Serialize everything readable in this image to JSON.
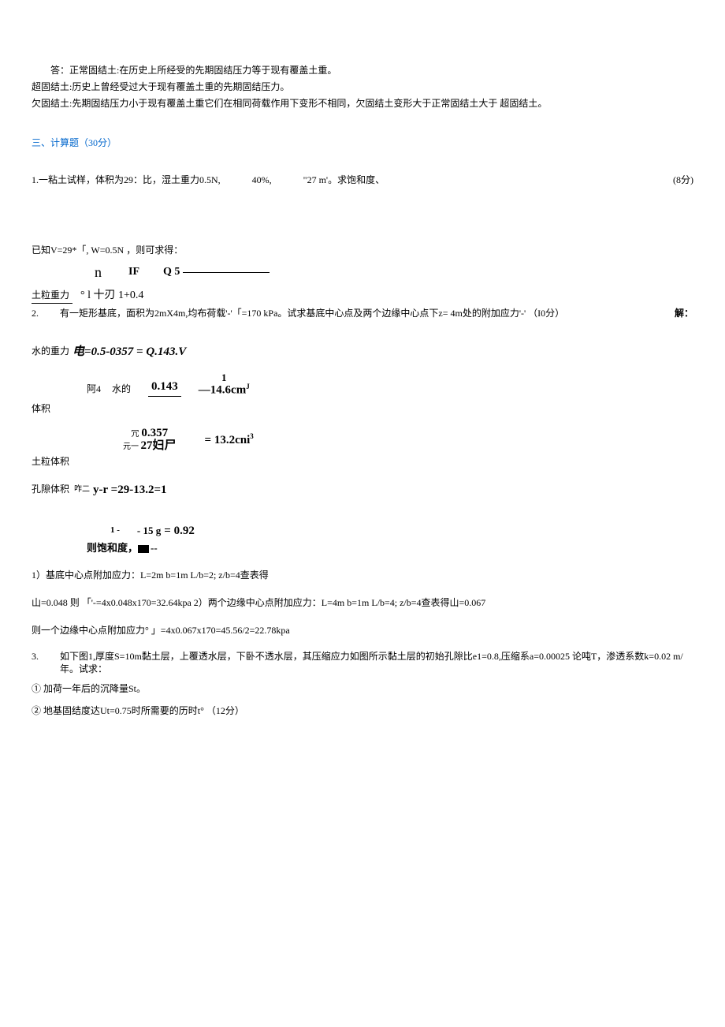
{
  "answer": {
    "line1": "答：正常固结土:在历史上所经受的先期固结压力等于现有覆盖土重。",
    "line2": "超固结土:历史上曾经受过大于现有覆盖土重的先期固结压力。",
    "line3": "欠固结土:先期固结压力小于现有覆盖土重它们在相同荷载作用下变形不相同，欠固结土变形大于正常固结土大于 超固结土。"
  },
  "section3": {
    "title": "三、计算题（30分）"
  },
  "q1": {
    "seg1": "1.一粘土试样，体积为29：比，湿土重力0.5N,",
    "seg2": "40%,",
    "seg3": "\"27 m'。求饱和度、",
    "seg4": "(8分)"
  },
  "known": "已知V=29*「, W=0.5N ，则可求得：",
  "eq1": {
    "top_n": "n",
    "top_if": "IF",
    "top_q5": "Q 5",
    "label": "土粒重力",
    "bot": "° l 十刃 1+0.4"
  },
  "q2": {
    "num": "2.",
    "body": "有一矩形基底，面积为2mX4m,均布荷载'-'「=170 kPa。试求基底中心点及两个边缘中心点下z= 4m处的附加应力'-' （I0分）",
    "end": "解："
  },
  "water_weight": {
    "label": "水的重力",
    "eq": "电=0.5-0357 = Q.143.V"
  },
  "water_vol": {
    "seg1": "阿4",
    "seg2": "水的",
    "seg3": "0.143",
    "seg4": "—14.6cm",
    "sup": "J",
    "sup_pre": "1",
    "label": "体积"
  },
  "soil_vol": {
    "pre1": "冗",
    "v1": "0.357",
    "pre2": "元一",
    "v2": "27妇尸",
    "eq": "= 13.2cni",
    "sup": "3",
    "label": "土粒体积"
  },
  "pore_vol": {
    "pre": "咋二",
    "eq": "y-r =29-13.2=1",
    "label": "孔隙体积"
  },
  "sat": {
    "pre1": "1 -",
    "pre2": "- 15 g",
    "eq": "= 0.92",
    "label1": "则饱和度",
    "label2": "，■--"
  },
  "p1": "1）基底中心点附加应力：L=2m b=1m L/b=2; z/b=4查表得",
  "p2": "山=0.048 则 「'-=4x0.048x170=32.64kpa 2）两个边缘中心点附加应力：L=4m b=1m L/b=4; z/b=4查表得山=0.067",
  "p3": "则一个边缘中心点附加应力° 」=4x0.067x170=45.56/2=22.78kpa",
  "q3": {
    "num": "3.",
    "body": "如下图1,厚度S=10m黏土层，上覆透水层，下卧不透水层，其压缩应力如图所示黏土层的初始孔隙比e1=0.8,压缩系a=0.00025 论吨T，渗透系数k=0.02 m/年。试求："
  },
  "q3a": "① 加荷一年后的沉降量St。",
  "q3b": "② 地基固结度达Ut=0.75时所需要的历时t° （12分）"
}
